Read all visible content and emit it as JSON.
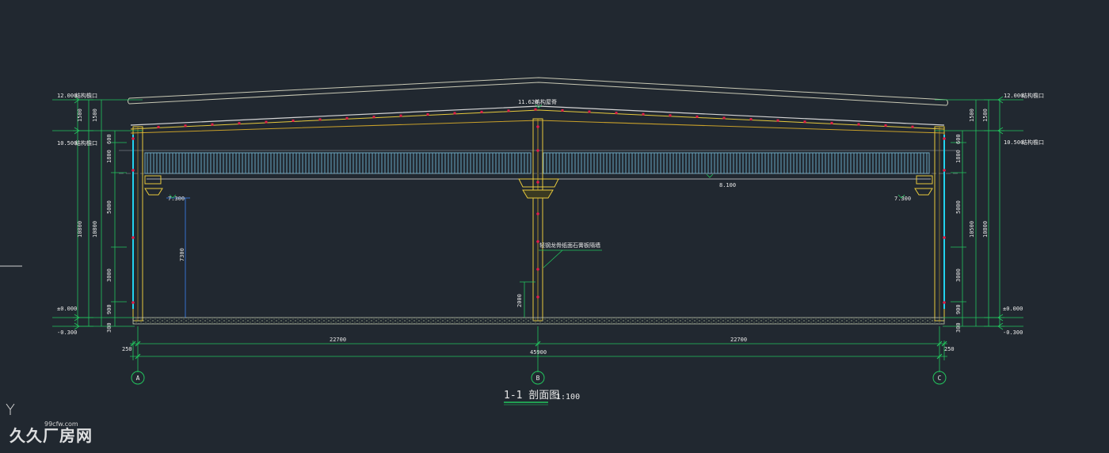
{
  "drawing": {
    "title": "1-1 剖面图",
    "scale": "1:100",
    "colors": {
      "background": "#212830",
      "roof": "#c8c8b4",
      "steel": "#e6c83c",
      "column_line": "#c8a02a",
      "dim_green": "#22c55e",
      "dim_text": "#e8e8e8",
      "blue": "#3b82f6",
      "cyan": "#22d3ee",
      "red_bolt": "#e11d48",
      "crane": "#5a8fa8"
    },
    "axes": [
      {
        "id": "A"
      },
      {
        "id": "B"
      },
      {
        "id": "C"
      }
    ],
    "levels": {
      "left": [
        {
          "value": "12.000",
          "note": "结构檐口"
        },
        {
          "value": "10.500",
          "note": "结构檐口"
        },
        {
          "value": "±0.000",
          "note": ""
        },
        {
          "value": "-0.300",
          "note": ""
        }
      ],
      "right": [
        {
          "value": "12.000",
          "note": "结构檐口"
        },
        {
          "value": "10.500",
          "note": "结构檐口"
        },
        {
          "value": "±0.000",
          "note": ""
        },
        {
          "value": "-0.300",
          "note": ""
        }
      ],
      "ridge": {
        "value": "11.620",
        "note": "结构屋脊"
      },
      "crane_left": "7.300",
      "crane_right": "7.300",
      "beam": "8.100"
    },
    "vertical_dims": {
      "left_outer": [
        "1500",
        "10800",
        "300"
      ],
      "left_inner": [
        "1500",
        "10800"
      ],
      "left_detail": [
        "600",
        "1800",
        "5000",
        "3000",
        "900",
        "300"
      ],
      "left_crane": "7300",
      "right_outer": [
        "1500",
        "10800",
        "300"
      ],
      "right_inner": [
        "1500",
        "10500"
      ],
      "right_detail": [
        "600",
        "1800",
        "5000",
        "3000",
        "900",
        "300"
      ],
      "center_low": "2000"
    },
    "horizontal_dims": {
      "span_left": "22700",
      "span_right": "22700",
      "total": "45900",
      "offset_left": "250",
      "offset_right": "250"
    },
    "annotation": "轻钢龙骨纸面石膏板隔墙"
  },
  "watermark": {
    "logo": "久久厂房网",
    "url": "99cfw.com"
  }
}
